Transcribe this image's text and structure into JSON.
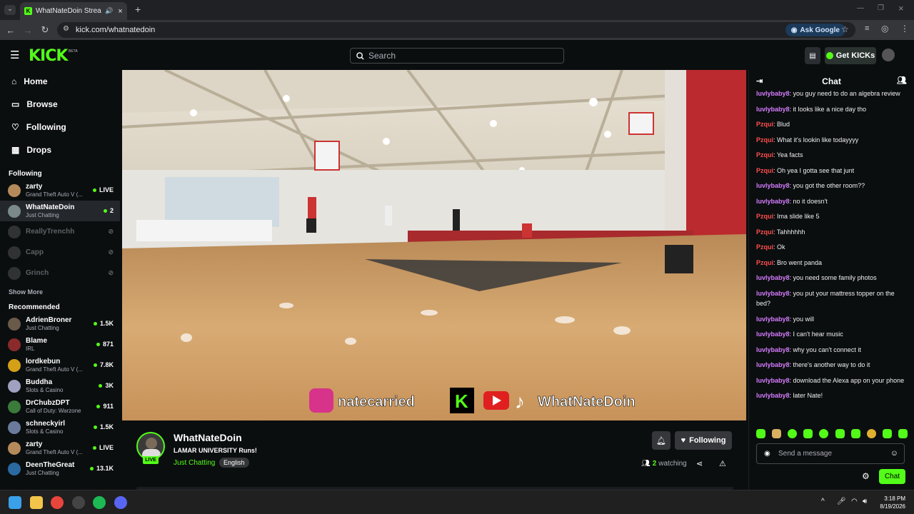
{
  "browser": {
    "tab_title": "WhatNateDoin Stream - W",
    "url": "kick.com/whatnatedoin",
    "ask_google": "Ask Google"
  },
  "header": {
    "logo": "KICK",
    "beta": "BETA",
    "search_placeholder": "Search",
    "get_kicks": "Get KICKs"
  },
  "sidebar": {
    "nav": [
      {
        "label": "Home",
        "icon": "home-icon"
      },
      {
        "label": "Browse",
        "icon": "browse-icon"
      },
      {
        "label": "Following",
        "icon": "heart-icon"
      },
      {
        "label": "Drops",
        "icon": "drops-icon"
      }
    ],
    "following_title": "Following",
    "following": [
      {
        "name": "zarty",
        "category": "Grand Theft Auto V (...",
        "viewers": "LIVE",
        "color": "#b48a5a"
      },
      {
        "name": "WhatNateDoin",
        "category": "Just Chatting",
        "viewers": "2",
        "color": "#7a8a8a"
      },
      {
        "name": "ReallyTrenchh",
        "category": "",
        "viewers": "",
        "color": "#888"
      },
      {
        "name": "Capp",
        "category": "",
        "viewers": "",
        "color": "#888"
      },
      {
        "name": "Grinch",
        "category": "",
        "viewers": "",
        "color": "#888"
      }
    ],
    "show_more": "Show More",
    "recommended_title": "Recommended",
    "recommended": [
      {
        "name": "AdrienBroner",
        "category": "Just Chatting",
        "viewers": "1.5K",
        "color": "#6a5a4a"
      },
      {
        "name": "Blame",
        "category": "IRL",
        "viewers": "871",
        "color": "#8a2a2a"
      },
      {
        "name": "lordkebun",
        "category": "Grand Theft Auto V (...",
        "viewers": "7.8K",
        "color": "#d4a017"
      },
      {
        "name": "Buddha",
        "category": "Slots & Casino",
        "viewers": "3K",
        "color": "#a0a0c0"
      },
      {
        "name": "DrChubzDPT",
        "category": "Call of Duty: Warzone",
        "viewers": "911",
        "color": "#3a7a3a"
      },
      {
        "name": "schneckyirl",
        "category": "Slots & Casino",
        "viewers": "1.5K",
        "color": "#6a7a9a"
      },
      {
        "name": "zarty",
        "category": "Grand Theft Auto V (...",
        "viewers": "LIVE",
        "color": "#b48a5a"
      },
      {
        "name": "DeenTheGreat",
        "category": "Just Chatting",
        "viewers": "13.1K",
        "color": "#2a6aa0"
      }
    ]
  },
  "video": {
    "overlay_instagram": "natecarried",
    "overlay_tiktok": "WhatNateDoin"
  },
  "stream": {
    "channel": "WhatNateDoin",
    "live": "LIVE",
    "title": "LAMAR UNIVERSITY Runs!",
    "category": "Just Chatting",
    "language": "English",
    "following_label": "Following",
    "viewers": "2",
    "watching_label": "watching"
  },
  "chat": {
    "title": "Chat",
    "messages": [
      {
        "user": "luvlybaby8",
        "text": "you guy need to do an algebra review",
        "color": "#d67cff"
      },
      {
        "user": "luvlybaby8",
        "text": "it looks like a nice day tho",
        "color": "#d67cff"
      },
      {
        "user": "Pzqui",
        "text": "Blud",
        "color": "#ff4d4d"
      },
      {
        "user": "Pzqui",
        "text": "What it's lookin like todayyyy",
        "color": "#ff4d4d"
      },
      {
        "user": "Pzqui",
        "text": "Yea facts",
        "color": "#ff4d4d"
      },
      {
        "user": "Pzqui",
        "text": "Oh yea I gotta see that junt",
        "color": "#ff4d4d"
      },
      {
        "user": "luvlybaby8",
        "text": "you got the other room??",
        "color": "#d67cff"
      },
      {
        "user": "luvlybaby8",
        "text": "no it doesn't",
        "color": "#d67cff"
      },
      {
        "user": "Pzqui",
        "text": "Ima slide like 5",
        "color": "#ff4d4d"
      },
      {
        "user": "Pzqui",
        "text": "Tahhhhhh",
        "color": "#ff4d4d"
      },
      {
        "user": "Pzqui",
        "text": "Ok",
        "color": "#ff4d4d"
      },
      {
        "user": "Pzqui",
        "text": "Bro went panda",
        "color": "#ff4d4d"
      },
      {
        "user": "luvlybaby8",
        "text": "you need some family photos",
        "color": "#d67cff"
      },
      {
        "user": "luvlybaby8",
        "text": "you put your mattress topper on the bed?",
        "color": "#d67cff"
      },
      {
        "user": "luvlybaby8",
        "text": "you will",
        "color": "#d67cff"
      },
      {
        "user": "luvlybaby8",
        "text": "I can't hear music",
        "color": "#d67cff"
      },
      {
        "user": "luvlybaby8",
        "text": "why you can't connect it",
        "color": "#d67cff"
      },
      {
        "user": "luvlybaby8",
        "text": "there's another way to do it",
        "color": "#d67cff"
      },
      {
        "user": "luvlybaby8",
        "text": "download the Alexa app on your phone",
        "color": "#d67cff"
      },
      {
        "user": "luvlybaby8",
        "text": "later Nate!",
        "color": "#d67cff"
      }
    ],
    "input_placeholder": "Send a message",
    "send_label": "Chat"
  },
  "taskbar": {
    "time": "3:18 PM",
    "date": "8/19/2026"
  },
  "colors": {
    "accent": "#53fc18",
    "bg": "#0b0e0f"
  }
}
